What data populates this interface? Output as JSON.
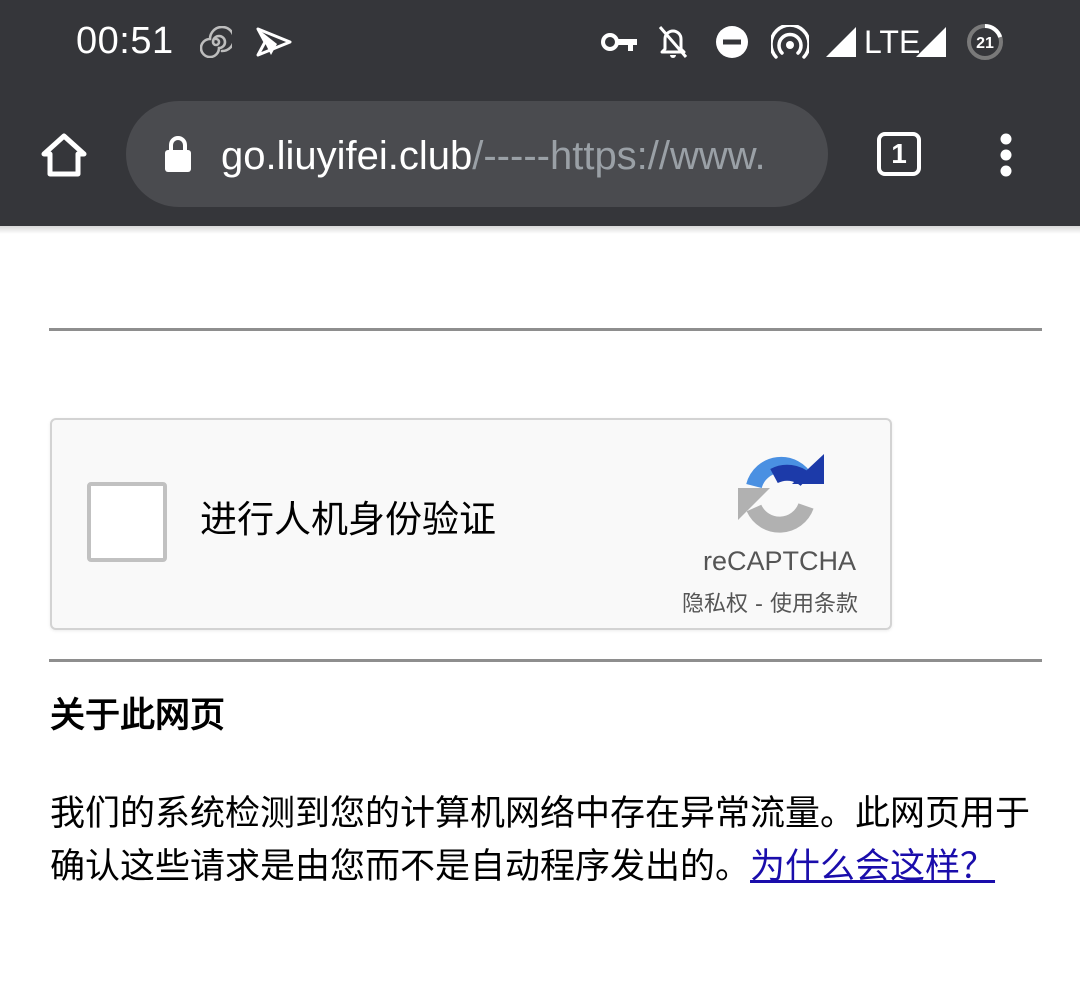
{
  "status_bar": {
    "time": "00:51",
    "network_label": "LTE",
    "battery_level": "21",
    "icons": [
      "spiral-icon",
      "paper-plane-icon",
      "vpn-key-icon",
      "bell-off-icon",
      "do-not-disturb-icon",
      "hotspot-icon",
      "signal-icon",
      "lte-signal-icon",
      "battery-icon"
    ]
  },
  "toolbar": {
    "url_host": "go.liuyifei.club",
    "url_rest": "/-----https://www.",
    "tab_count": "1",
    "icons": [
      "home-icon",
      "lock-icon",
      "more-vert-icon"
    ]
  },
  "recaptcha": {
    "label": "进行人机身份验证",
    "brand": "reCAPTCHA",
    "privacy": "隐私权",
    "separator": " - ",
    "terms": "使用条款",
    "colors": {
      "arrow_blue": "#1c3aa9",
      "arrow_light_blue": "#4a90e2",
      "arrow_gray": "#b1b1b1"
    }
  },
  "about": {
    "heading": "关于此网页",
    "body": "我们的系统检测到您的计算机网络中存在异常流量。此网页用于确认这些请求是由您而不是自动程序发出的。",
    "link": "为什么会这样？"
  },
  "colors": {
    "toolbar_bg": "#35363a",
    "omnibox_bg": "#4a4b4f",
    "link": "#1a0dab"
  }
}
